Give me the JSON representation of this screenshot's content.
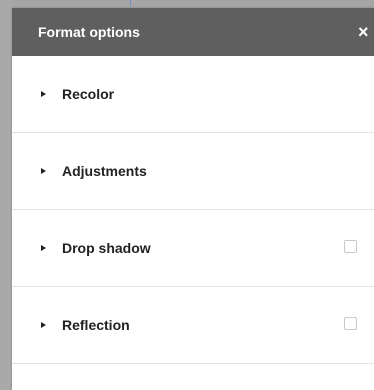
{
  "panel": {
    "title": "Format options",
    "close_glyph": "×"
  },
  "sections": [
    {
      "label": "Recolor",
      "has_checkbox": false
    },
    {
      "label": "Adjustments",
      "has_checkbox": false
    },
    {
      "label": "Drop shadow",
      "has_checkbox": true,
      "checked": false
    },
    {
      "label": "Reflection",
      "has_checkbox": true,
      "checked": false
    }
  ],
  "icons": {
    "expand": "triangle-right-icon",
    "close": "close-icon"
  },
  "colors": {
    "header_bg": "#5f5f5f",
    "header_text": "#ffffff",
    "background_overlay": "#bcbcbc"
  }
}
